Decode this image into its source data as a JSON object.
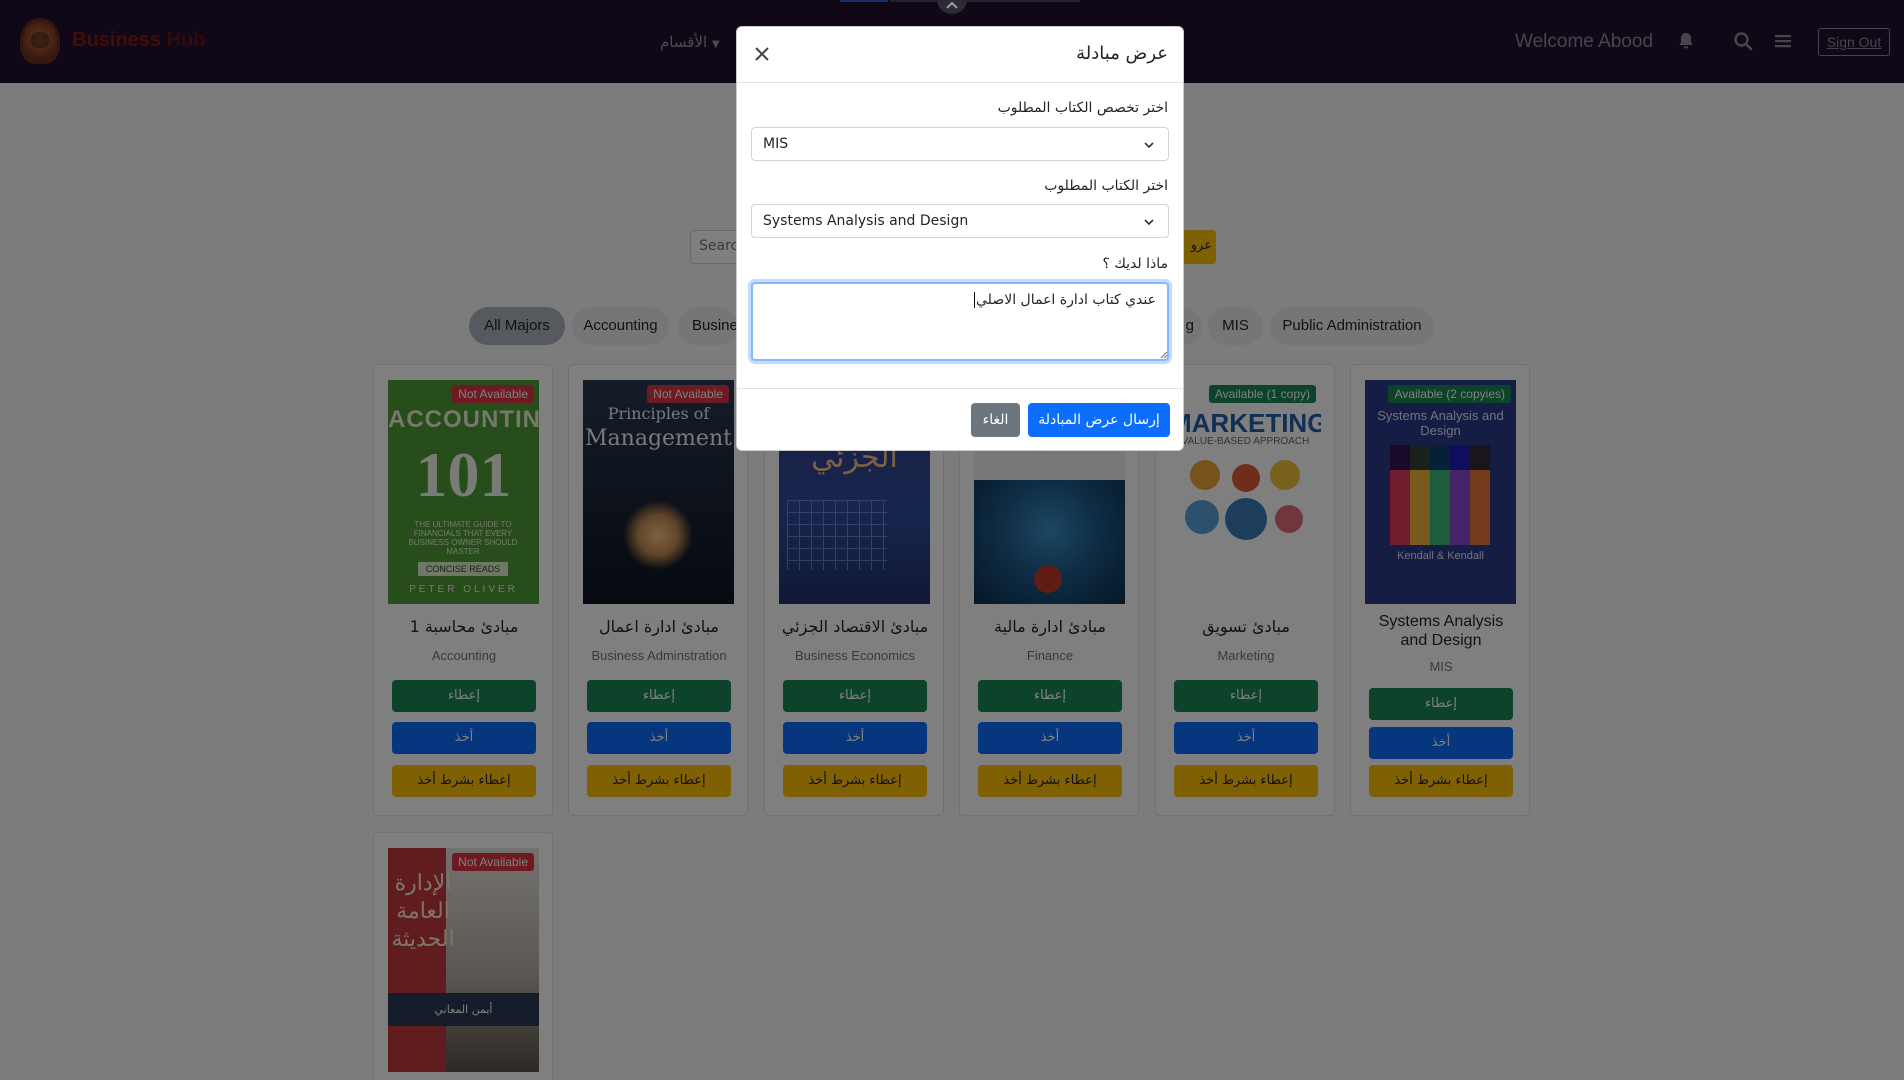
{
  "navbar": {
    "brand_main": "Business",
    "brand_hub": "Hub",
    "sections_label": "الأقسام",
    "welcome": "Welcome Abood",
    "sign_out": "Sign Out"
  },
  "search": {
    "placeholder": "Search",
    "offers_label": "عرو"
  },
  "majors": [
    "All Majors",
    "Accounting",
    "Busine",
    "g",
    "MIS",
    "Public Administration"
  ],
  "books": [
    {
      "title": "مبادئ محاسبة 1",
      "major": "Accounting",
      "status": "Not Available",
      "cover_main": "ACCOUNTING",
      "cover_num": "101",
      "cover_sub": "THE ULTIMATE GUIDE TO FINANCIALS THAT EVERY BUSINESS OWNER SHOULD MASTER",
      "cover_tag": "CONCISE READS",
      "cover_author": "PETER OLIVER"
    },
    {
      "title": "مبادئ ادارة اعمال",
      "major": "Business Adminstration",
      "status": "Not Available",
      "cover_main": "Principles of",
      "cover_sub": "Management"
    },
    {
      "title": "مبادئ الاقتصاد الجزئي",
      "major": "Business Economics",
      "status": "",
      "cover_main": "الجزئي"
    },
    {
      "title": "مبادئ ادارة مالية",
      "major": "Finance",
      "status": ""
    },
    {
      "title": "مبادئ تسويق",
      "major": "Marketing",
      "status": "Available (1 copy)",
      "cover_main": "MARKETING",
      "cover_sub": "VALUE-BASED APPROACH"
    },
    {
      "title": "Systems Analysis and Design",
      "major": "MIS",
      "status": "Available (2 copyies)",
      "cover_main": "Systems Analysis and Design",
      "cover_author": "Kendall & Kendall"
    },
    {
      "title": "",
      "major": "",
      "status": "Not Available",
      "cover_main": "الإدارة العامة الحديثة",
      "cover_author": "أيمن المعاني"
    }
  ],
  "actions": {
    "give": "إعطاء",
    "take": "أخذ",
    "give_cond": "إعطاء بشرط أخذ"
  },
  "modal": {
    "title": "عرض مبادلة",
    "major_label": "اختر تخصص الكتاب المطلوب",
    "major_value": "MIS",
    "book_label": "اختر الكتاب المطلوب",
    "book_value": "Systems Analysis and Design",
    "have_label": "ماذا لديك ؟",
    "have_value": "عندي كتاب ادارة اعمال الاصلي",
    "send_label": "إرسال عرض المبادلة",
    "cancel_label": "الغاء"
  },
  "colors": {
    "navbar": "#200f2e",
    "primary": "#0d6efd",
    "success": "#198754",
    "warning": "#ffc107",
    "danger": "#dc3545",
    "secondary": "#6c757d"
  }
}
